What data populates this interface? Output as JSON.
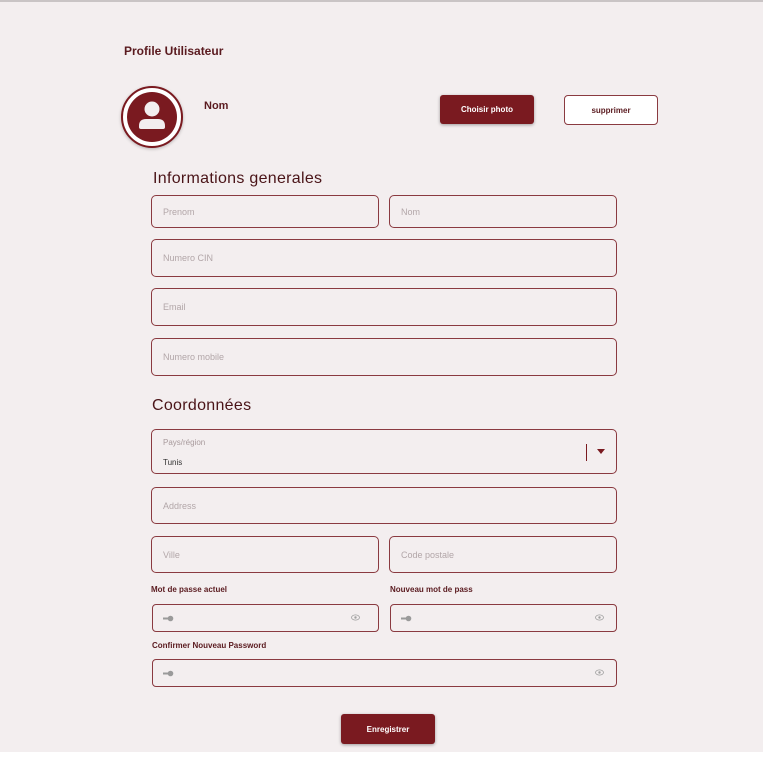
{
  "page": {
    "title": "Profile Utilisateur"
  },
  "profile": {
    "name_label": "Nom",
    "avatar_icon": "user-avatar-icon"
  },
  "actions": {
    "choose_photo": "Choisir photo",
    "delete": "supprimer",
    "save": "Enregistrer"
  },
  "general": {
    "heading": "Informations generales",
    "fields": {
      "prenom": {
        "placeholder": "Prenom",
        "value": ""
      },
      "nom": {
        "placeholder": "Nom",
        "value": ""
      },
      "cin": {
        "placeholder": "Numero CIN",
        "value": ""
      },
      "email": {
        "placeholder": "Email",
        "value": ""
      },
      "mobile": {
        "placeholder": "Numero mobile",
        "value": ""
      }
    }
  },
  "coordinates": {
    "heading": "Coordonnées",
    "country": {
      "label": "Pays/région",
      "value": "Tunis"
    },
    "fields": {
      "address": {
        "placeholder": "Address",
        "value": ""
      },
      "ville": {
        "placeholder": "Ville",
        "value": ""
      },
      "code_postale": {
        "placeholder": "Code postale",
        "value": ""
      }
    }
  },
  "passwords": {
    "current_label": "Mot de passe actuel",
    "new_label": "Nouveau mot de pass",
    "confirm_label": "Confirmer Nouveau Password",
    "icons": {
      "left": "key-icon",
      "right": "eye-icon"
    }
  },
  "colors": {
    "accent": "#7a1a20",
    "background": "#f3eeef",
    "border": "#8a3a40"
  }
}
